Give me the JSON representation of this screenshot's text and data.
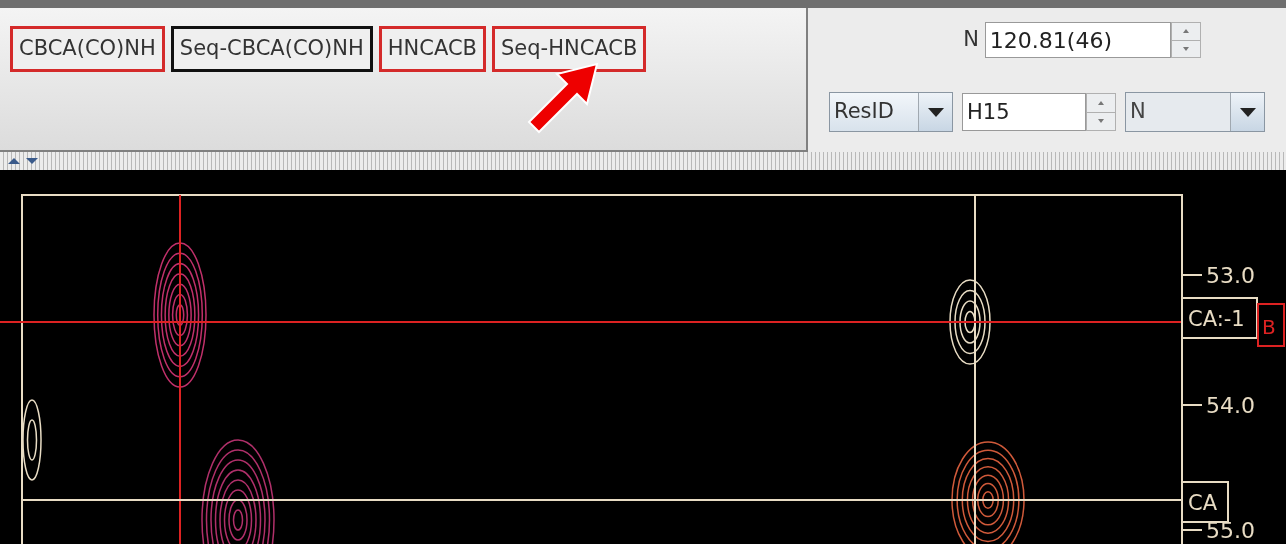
{
  "experiment_buttons": [
    {
      "label": "CBCA(CO)NH",
      "selected": false
    },
    {
      "label": "Seq-CBCA(CO)NH",
      "selected": true
    },
    {
      "label": "HNCACB",
      "selected": false
    },
    {
      "label": "Seq-HNCACB",
      "selected": false
    }
  ],
  "shift_field": {
    "label": "N",
    "value": "120.81(46)"
  },
  "residue_row": {
    "mode": "ResID",
    "residue": "H15",
    "atom": "N"
  },
  "spectrum": {
    "y_ticks": [
      "53.0",
      "54.0",
      "55.0"
    ],
    "peak_labels": [
      {
        "text": "CA:-1",
        "tag": "B"
      },
      {
        "text": "CA"
      }
    ]
  }
}
